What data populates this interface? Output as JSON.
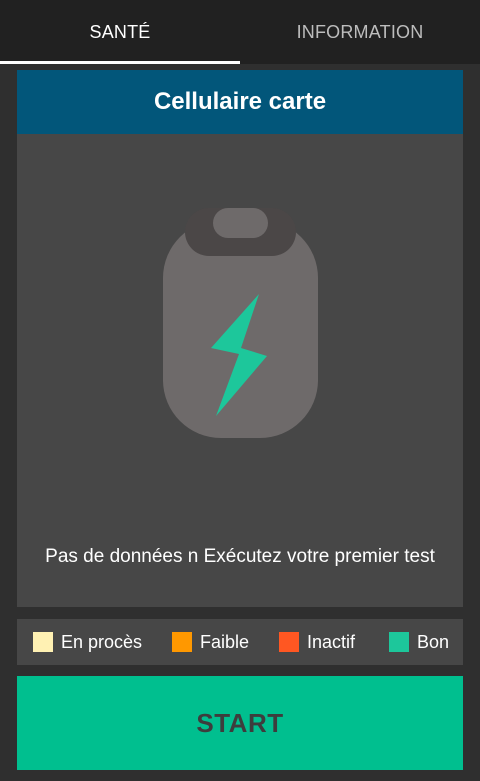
{
  "tabs": [
    {
      "label": "SANTÉ",
      "selected": true
    },
    {
      "label": "INFORMATION",
      "selected": false
    }
  ],
  "card": {
    "title": "Cellulaire carte",
    "message": "Pas de données n Exécutez votre premier test",
    "icon": "battery-charging-icon"
  },
  "legend": [
    {
      "label": "En procès",
      "color": "#fff1b3"
    },
    {
      "label": "Faible",
      "color": "#ff9800"
    },
    {
      "label": "Inactif",
      "color": "#ff5722"
    },
    {
      "label": "Bon",
      "color": "#1dc79b"
    }
  ],
  "start_button": {
    "label": "START"
  },
  "colors": {
    "header_bg": "#02567a",
    "accent": "#00bf8f",
    "battery_body": "#6e6a6a",
    "bolt": "#1dc79b"
  }
}
